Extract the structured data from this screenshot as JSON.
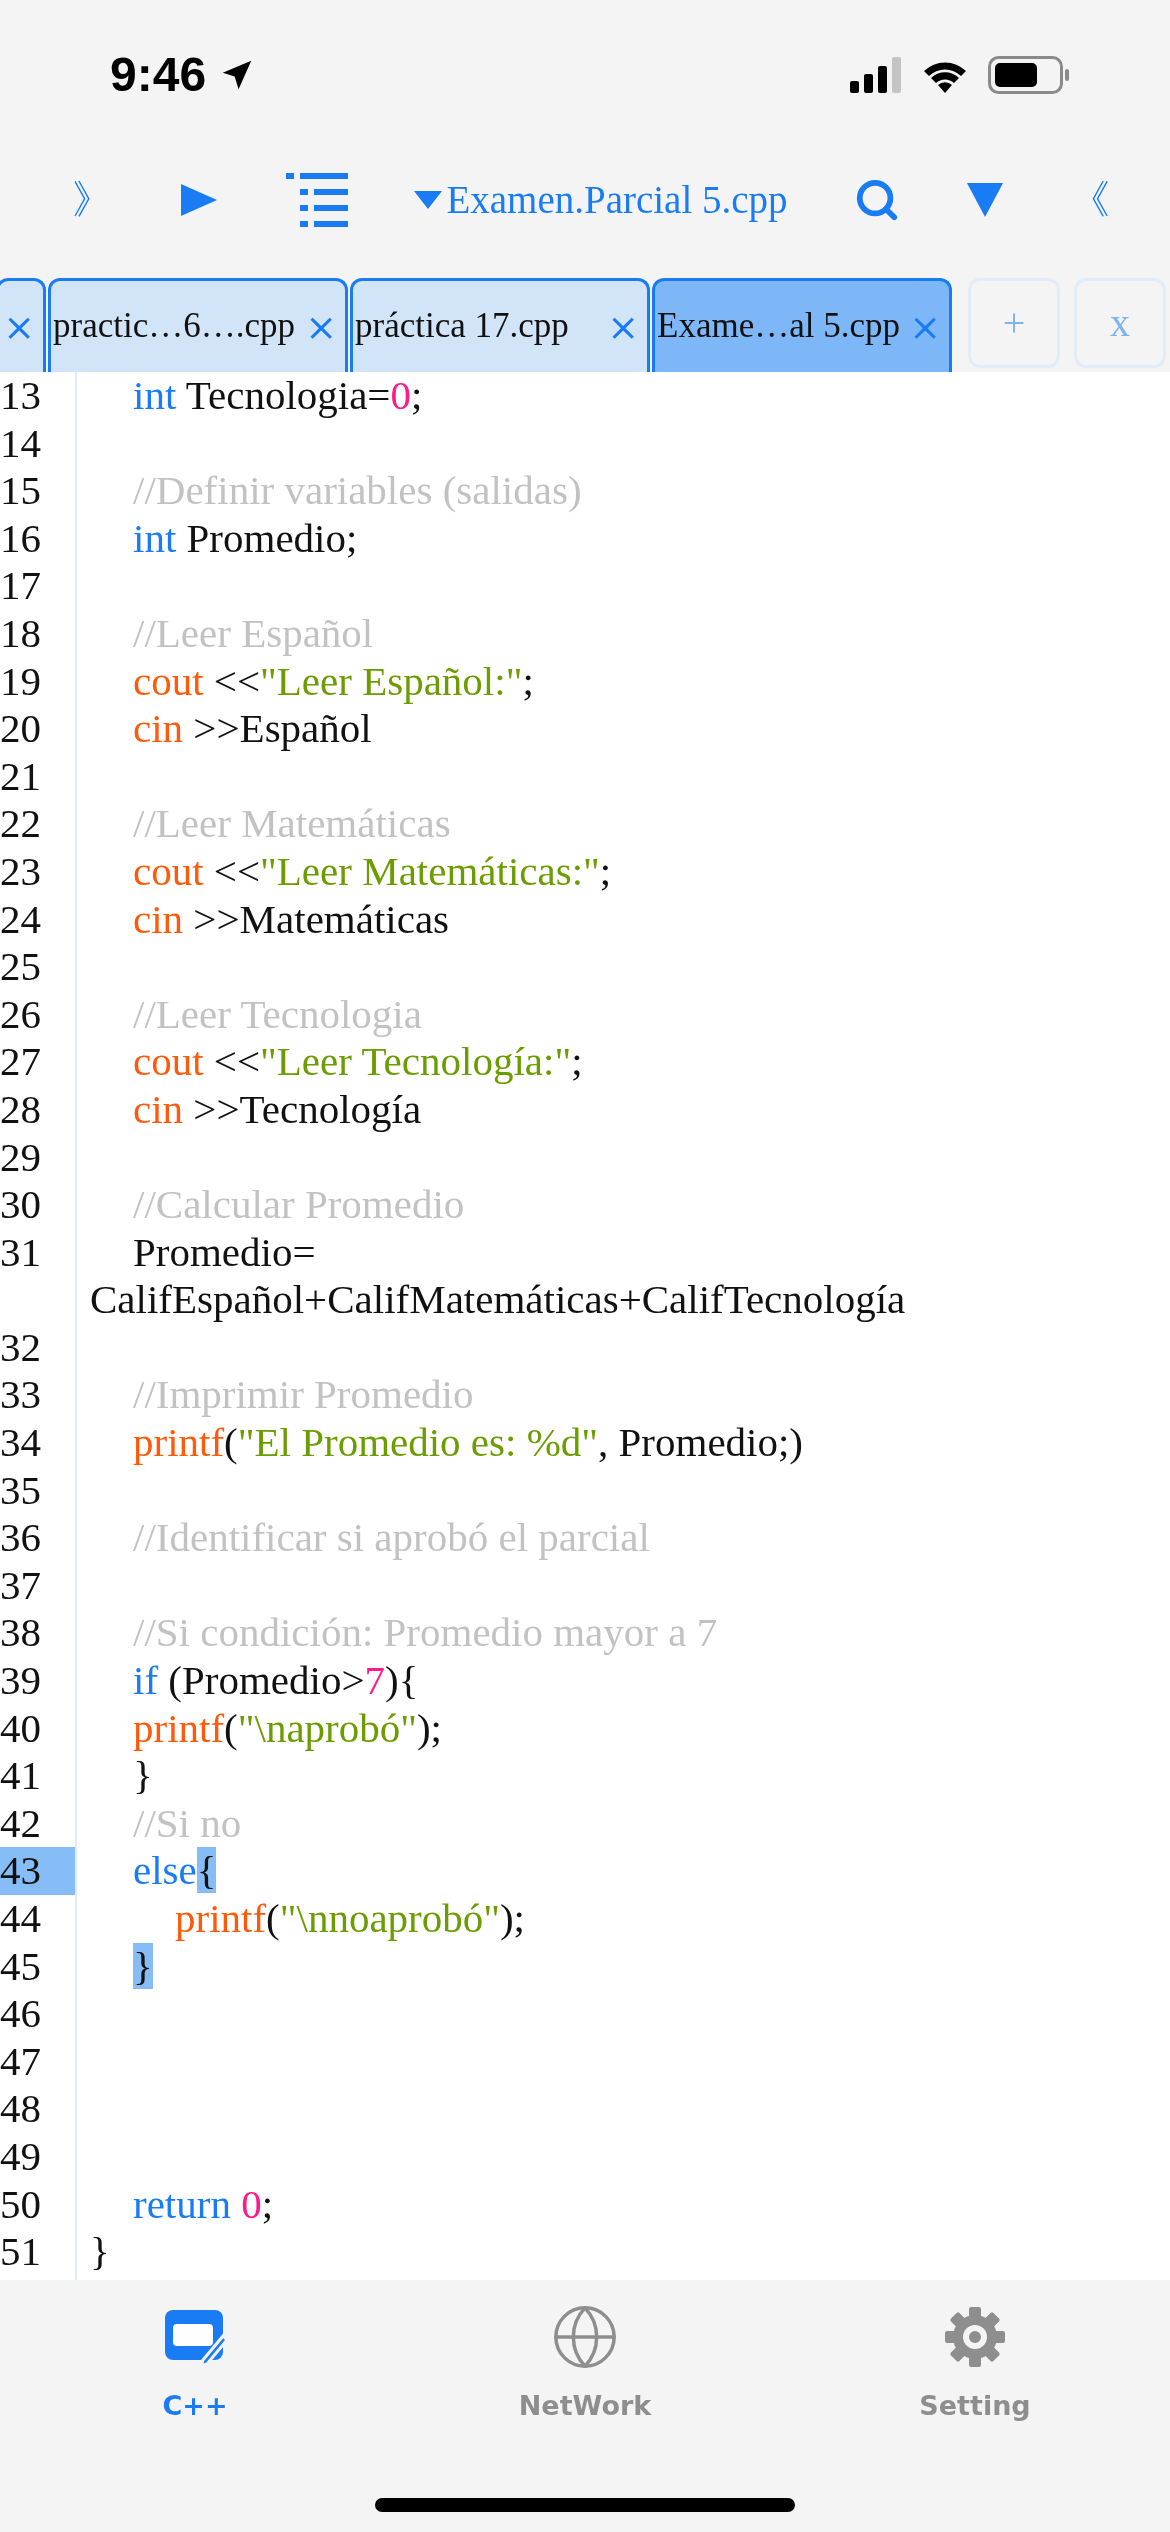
{
  "status_bar": {
    "time": "9:46"
  },
  "toolbar": {
    "left_glyph": "》",
    "file_title": "Examen.Parcial 5.cpp",
    "right_glyph": "《"
  },
  "tabs": [
    {
      "close": "×",
      "selected": false
    },
    {
      "label": "practic…6….cpp",
      "close": "×",
      "selected": false
    },
    {
      "label": "práctica 17.cpp",
      "close": "×",
      "selected": false
    },
    {
      "label": "Exame…al 5.cpp",
      "close": "×",
      "selected": true
    }
  ],
  "tab_actions": [
    "+",
    "x"
  ],
  "editor": {
    "lines": [
      {
        "number": "13",
        "kind": "body",
        "selected": false,
        "tokens": [
          {
            "kind": "keyword",
            "text": "int"
          },
          {
            "kind": "plain",
            "text": " Tecnologia="
          },
          {
            "kind": "number",
            "text": "0"
          },
          {
            "kind": "plain",
            "text": ";"
          }
        ]
      },
      {
        "number": "14",
        "kind": "blank",
        "selected": false
      },
      {
        "number": "15",
        "kind": "body",
        "selected": false,
        "tokens": [
          {
            "kind": "comment",
            "text": "//Definir variables (salidas)"
          }
        ]
      },
      {
        "number": "16",
        "kind": "body",
        "selected": false,
        "tokens": [
          {
            "kind": "keyword",
            "text": "int"
          },
          {
            "kind": "plain",
            "text": " Promedio;"
          }
        ]
      },
      {
        "number": "17",
        "kind": "blank",
        "selected": false
      },
      {
        "number": "18",
        "kind": "body",
        "selected": false,
        "tokens": [
          {
            "kind": "comment",
            "text": "//Leer Español"
          }
        ]
      },
      {
        "number": "19",
        "kind": "body",
        "selected": false,
        "tokens": [
          {
            "kind": "function",
            "text": "cout"
          },
          {
            "kind": "plain",
            "text": " <<"
          },
          {
            "kind": "string",
            "text": "\"Leer Español:\""
          },
          {
            "kind": "plain",
            "text": ";"
          }
        ]
      },
      {
        "number": "20",
        "kind": "body",
        "selected": false,
        "tokens": [
          {
            "kind": "function",
            "text": "cin"
          },
          {
            "kind": "plain",
            "text": " >>Español"
          }
        ]
      },
      {
        "number": "21",
        "kind": "blank",
        "selected": false
      },
      {
        "number": "22",
        "kind": "body",
        "selected": false,
        "tokens": [
          {
            "kind": "comment",
            "text": "//Leer Matemáticas"
          }
        ]
      },
      {
        "number": "23",
        "kind": "body",
        "selected": false,
        "tokens": [
          {
            "kind": "function",
            "text": "cout"
          },
          {
            "kind": "plain",
            "text": " <<"
          },
          {
            "kind": "string",
            "text": "\"Leer Matemáticas:\""
          },
          {
            "kind": "plain",
            "text": ";"
          }
        ]
      },
      {
        "number": "24",
        "kind": "body",
        "selected": false,
        "tokens": [
          {
            "kind": "function",
            "text": "cin"
          },
          {
            "kind": "plain",
            "text": " >>Matemáticas"
          }
        ]
      },
      {
        "number": "25",
        "kind": "blank",
        "selected": false
      },
      {
        "number": "26",
        "kind": "body",
        "selected": false,
        "tokens": [
          {
            "kind": "comment",
            "text": "//Leer Tecnologia"
          }
        ]
      },
      {
        "number": "27",
        "kind": "body",
        "selected": false,
        "tokens": [
          {
            "kind": "function",
            "text": "cout"
          },
          {
            "kind": "plain",
            "text": " <<"
          },
          {
            "kind": "string",
            "text": "\"Leer Tecnología:\""
          },
          {
            "kind": "plain",
            "text": ";"
          }
        ]
      },
      {
        "number": "28",
        "kind": "body",
        "selected": false,
        "tokens": [
          {
            "kind": "function",
            "text": "cin"
          },
          {
            "kind": "plain",
            "text": " >>Tecnología"
          }
        ]
      },
      {
        "number": "29",
        "kind": "blank",
        "selected": false
      },
      {
        "number": "30",
        "kind": "body",
        "selected": false,
        "tokens": [
          {
            "kind": "comment",
            "text": "//Calcular Promedio"
          }
        ]
      },
      {
        "number": "31",
        "kind": "body",
        "selected": false,
        "tokens": [
          {
            "kind": "plain",
            "text": "Promedio= CalifEspañol+CalifMatemáticas+CalifTecnología"
          }
        ]
      },
      {
        "number": "32",
        "kind": "blank",
        "selected": false
      },
      {
        "number": "33",
        "kind": "body",
        "selected": false,
        "tokens": [
          {
            "kind": "comment",
            "text": "//Imprimir Promedio"
          }
        ]
      },
      {
        "number": "34",
        "kind": "body",
        "selected": false,
        "tokens": [
          {
            "kind": "function",
            "text": "printf"
          },
          {
            "kind": "plain",
            "text": "("
          },
          {
            "kind": "string",
            "text": "\"El Promedio es: %d\""
          },
          {
            "kind": "plain",
            "text": ", Promedio;)"
          }
        ]
      },
      {
        "number": "35",
        "kind": "blank",
        "selected": false
      },
      {
        "number": "36",
        "kind": "body",
        "selected": false,
        "tokens": [
          {
            "kind": "comment",
            "text": "//Identificar si aprobó el parcial"
          }
        ]
      },
      {
        "number": "37",
        "kind": "blank",
        "selected": false
      },
      {
        "number": "38",
        "kind": "body",
        "selected": false,
        "tokens": [
          {
            "kind": "comment",
            "text": "//Si condición: Promedio mayor a 7"
          }
        ]
      },
      {
        "number": "39",
        "kind": "body",
        "selected": false,
        "tokens": [
          {
            "kind": "keyword",
            "text": "if"
          },
          {
            "kind": "plain",
            "text": " (Promedio>"
          },
          {
            "kind": "number",
            "text": "7"
          },
          {
            "kind": "plain",
            "text": "){"
          }
        ]
      },
      {
        "number": "40",
        "kind": "body",
        "selected": false,
        "tokens": [
          {
            "kind": "function",
            "text": "printf"
          },
          {
            "kind": "plain",
            "text": "("
          },
          {
            "kind": "string",
            "text": "\"\\naprobó\""
          },
          {
            "kind": "plain",
            "text": ");"
          }
        ]
      },
      {
        "number": "41",
        "kind": "body",
        "selected": false,
        "tokens": [
          {
            "kind": "plain",
            "text": "}"
          }
        ]
      },
      {
        "number": "42",
        "kind": "body",
        "selected": false,
        "tokens": [
          {
            "kind": "comment",
            "text": "//Si no"
          }
        ]
      },
      {
        "number": "43",
        "kind": "body",
        "selected": true,
        "tokens": [
          {
            "kind": "keyword",
            "text": "else"
          },
          {
            "kind": "match",
            "text": "{"
          }
        ]
      },
      {
        "number": "44",
        "kind": "nested",
        "selected": false,
        "tokens": [
          {
            "kind": "function",
            "text": "printf"
          },
          {
            "kind": "plain",
            "text": "("
          },
          {
            "kind": "string",
            "text": "\"\\nnoaprobó\""
          },
          {
            "kind": "plain",
            "text": ");"
          }
        ]
      },
      {
        "number": "45",
        "kind": "body",
        "selected": false,
        "tokens": [
          {
            "kind": "match",
            "text": "}"
          }
        ]
      },
      {
        "number": "46",
        "kind": "blank",
        "selected": false
      },
      {
        "number": "47",
        "kind": "blank",
        "selected": false
      },
      {
        "number": "48",
        "kind": "blank",
        "selected": false
      },
      {
        "number": "49",
        "kind": "blank",
        "selected": false
      },
      {
        "number": "50",
        "kind": "body",
        "selected": false,
        "tokens": [
          {
            "kind": "keyword",
            "text": "return "
          },
          {
            "kind": "number",
            "text": "0"
          },
          {
            "kind": "plain",
            "text": ";"
          }
        ]
      },
      {
        "number": "51",
        "kind": "top",
        "selected": false,
        "tokens": [
          {
            "kind": "plain",
            "text": "}"
          }
        ]
      }
    ]
  },
  "bottom_nav": [
    {
      "label": "C++",
      "kind": "editor",
      "selected": true
    },
    {
      "label": "NetWork",
      "kind": "network",
      "selected": false
    },
    {
      "label": "Setting",
      "kind": "settings",
      "selected": false
    }
  ]
}
